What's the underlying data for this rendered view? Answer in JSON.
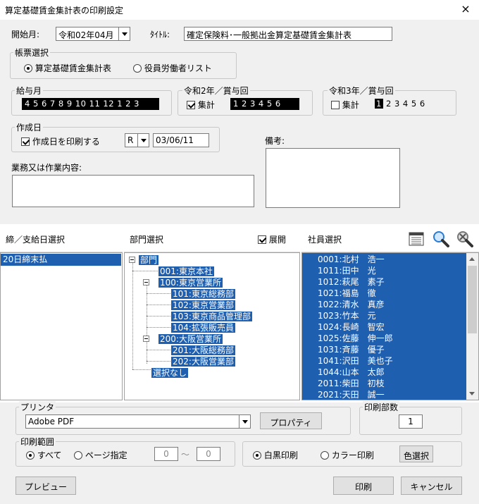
{
  "window": {
    "title": "算定基礎賃金集計表の印刷設定",
    "close": "×"
  },
  "start_month": {
    "label": "開始月:",
    "value": "令和02年04月"
  },
  "title_field": {
    "label": "ﾀｲﾄﾙ:",
    "value": "確定保険料･一般拠出金算定基礎賃金集計表"
  },
  "form_select": {
    "title": "帳票選択",
    "options": [
      "算定基礎賃金集計表",
      "役員労働者リスト"
    ],
    "selected": 0
  },
  "salary_month": {
    "title": "給与月",
    "values": "4 5 6 7 8 9 10 11 12 1 2 3"
  },
  "r2_bonus": {
    "title": "令和2年／賞与回",
    "check_label": "集計",
    "checked": true,
    "values": "1 2 3 4 5 6"
  },
  "r3_bonus": {
    "title": "令和3年／賞与回",
    "check_label": "集計",
    "checked": false,
    "first": "1",
    "rest": "2 3 4 5 6"
  },
  "creation_date": {
    "title": "作成日",
    "check_label": "作成日を印刷する",
    "checked": true,
    "era": "R",
    "date": "03/06/11"
  },
  "remarks": {
    "label": "備考:"
  },
  "work_content": {
    "label": "業務又は作業内容:"
  },
  "closing": {
    "header": "締／支給日選択",
    "items": [
      "20日締末払"
    ]
  },
  "dept": {
    "header": "部門選択",
    "expand_label": "展開",
    "expand_checked": true,
    "items": [
      "部門",
      "001:東京本社",
      "100:東京営業所",
      "101:東京総務部",
      "102:東京営業部",
      "103:東京商品管理部",
      "104:拡張販売員",
      "200:大阪営業所",
      "201:大阪総務部",
      "202:大阪営業部",
      "選択なし"
    ]
  },
  "employees": {
    "header": "社員選択",
    "icons": [
      "list-icon",
      "search-icon",
      "search-clear-icon"
    ],
    "items": [
      "0001:北村　浩一",
      "1011:田中　光",
      "1012:萩尾　素子",
      "1021:福島　徹",
      "1022:清水　真彦",
      "1023:竹本　元",
      "1024:長崎　智宏",
      "1025:佐藤　伸一郎",
      "1031:斉藤　優子",
      "1041:沢田　美也子",
      "1044:山本　太郎",
      "2011:柴田　初枝",
      "2021:天田　誠一"
    ]
  },
  "printer": {
    "title": "プリンタ",
    "value": "Adobe PDF",
    "properties_button": "プロパティ"
  },
  "copies": {
    "title": "印刷部数",
    "value": "1"
  },
  "print_range": {
    "title": "印刷範囲",
    "all": "すべて",
    "pages": "ページ指定",
    "from": "0",
    "tilde": "～",
    "to": "0"
  },
  "color_mode": {
    "mono": "白黒印刷",
    "color": "カラー印刷",
    "select_button": "色選択"
  },
  "buttons": {
    "preview": "プレビュー",
    "print": "印刷",
    "cancel": "キャンセル"
  }
}
